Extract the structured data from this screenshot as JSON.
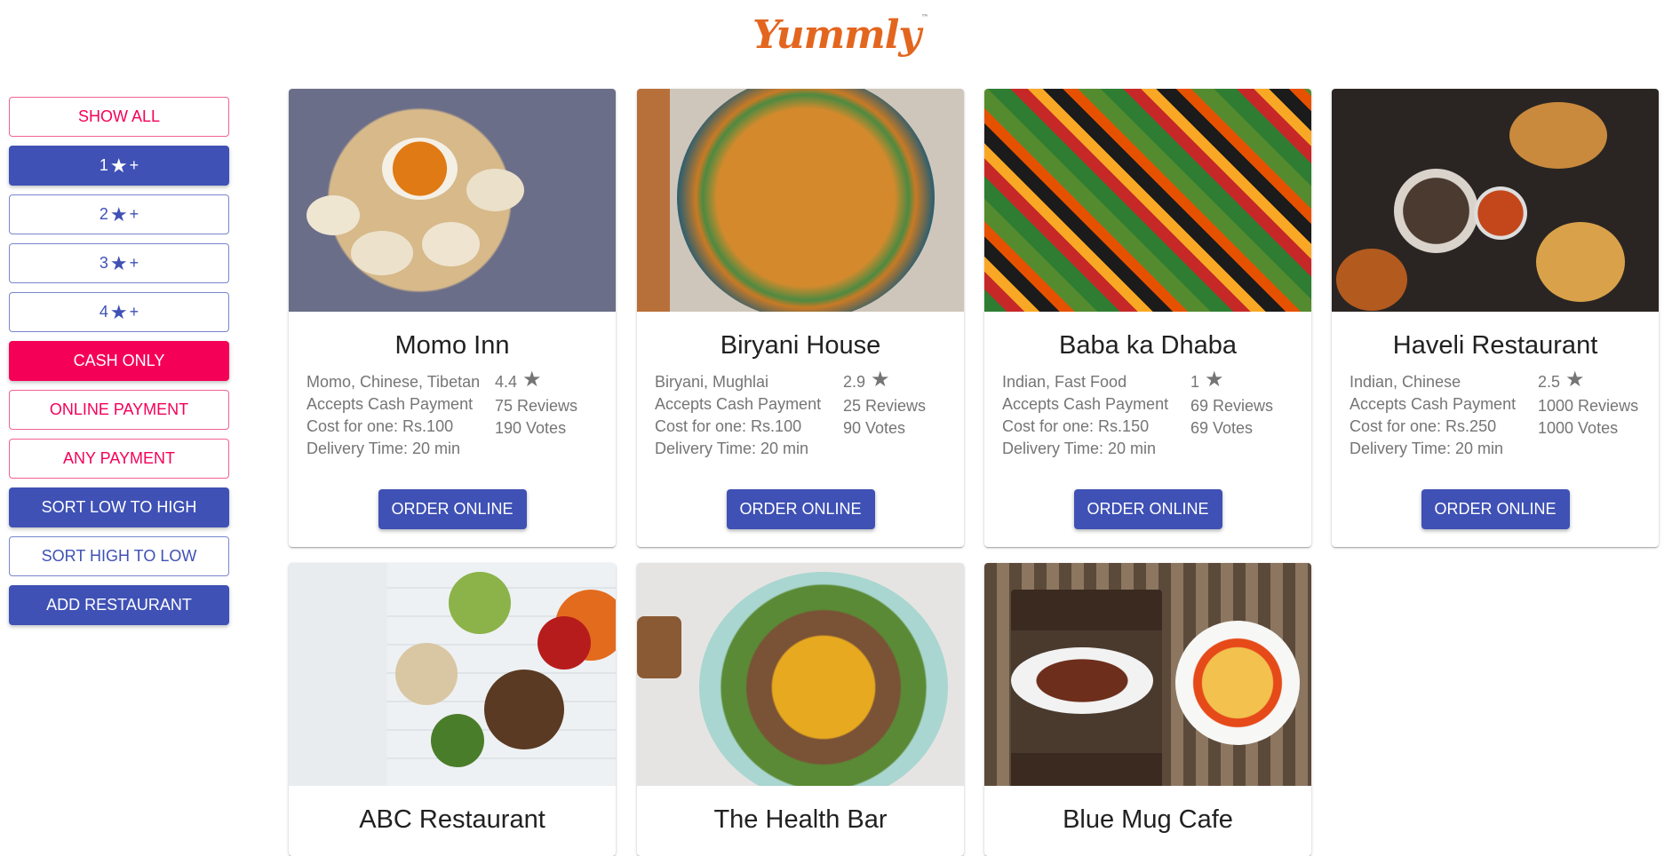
{
  "header": {
    "logo_text": "Yummly",
    "logo_mark": "™"
  },
  "filters": [
    {
      "label_pre": "SHOW ALL",
      "star": "",
      "label_post": "",
      "style": "o-pink"
    },
    {
      "label_pre": "1",
      "star": "★",
      "label_post": "+",
      "style": "c-indigo"
    },
    {
      "label_pre": "2",
      "star": "★",
      "label_post": "+",
      "style": "o-indigo"
    },
    {
      "label_pre": "3",
      "star": "★",
      "label_post": "+",
      "style": "o-indigo"
    },
    {
      "label_pre": "4",
      "star": "★",
      "label_post": "+",
      "style": "o-indigo"
    },
    {
      "label_pre": "CASH ONLY",
      "star": "",
      "label_post": "",
      "style": "c-pink"
    },
    {
      "label_pre": "ONLINE PAYMENT",
      "star": "",
      "label_post": "",
      "style": "o-pink"
    },
    {
      "label_pre": "ANY PAYMENT",
      "star": "",
      "label_post": "",
      "style": "o-pink"
    },
    {
      "label_pre": "SORT LOW TO HIGH",
      "star": "",
      "label_post": "",
      "style": "c-indigo"
    },
    {
      "label_pre": "SORT HIGH TO LOW",
      "star": "",
      "label_post": "",
      "style": "o-indigo"
    },
    {
      "label_pre": "ADD RESTAURANT",
      "star": "",
      "label_post": "",
      "style": "c-indigo"
    }
  ],
  "restaurants": [
    {
      "name": "Momo Inn",
      "cuisine": "Momo, Chinese, Tibetan",
      "payment": "Accepts Cash Payment",
      "cost": "Cost for one: Rs.100",
      "delivery": "Delivery Time: 20 min",
      "rating": "4.4",
      "reviews": "75 Reviews",
      "votes": "190 Votes",
      "order_label": "ORDER ONLINE"
    },
    {
      "name": "Biryani House",
      "cuisine": "Biryani, Mughlai",
      "payment": "Accepts Cash Payment",
      "cost": "Cost for one: Rs.100",
      "delivery": "Delivery Time: 20 min",
      "rating": "2.9",
      "reviews": "25 Reviews",
      "votes": "90 Votes",
      "order_label": "ORDER ONLINE"
    },
    {
      "name": "Baba ka Dhaba",
      "cuisine": "Indian, Fast Food",
      "payment": "Accepts Cash Payment",
      "cost": "Cost for one: Rs.150",
      "delivery": "Delivery Time: 20 min",
      "rating": "1",
      "reviews": "69 Reviews",
      "votes": "69 Votes",
      "order_label": "ORDER ONLINE"
    },
    {
      "name": "Haveli Restaurant",
      "cuisine": "Indian, Chinese",
      "payment": "Accepts Cash Payment",
      "cost": "Cost for one: Rs.250",
      "delivery": "Delivery Time: 20 min",
      "rating": "2.5",
      "reviews": "1000 Reviews",
      "votes": "1000 Votes",
      "order_label": "ORDER ONLINE"
    },
    {
      "name": "ABC Restaurant"
    },
    {
      "name": "The Health Bar"
    },
    {
      "name": "Blue Mug Cafe"
    }
  ],
  "rating_star": "★",
  "colors": {
    "primary": "#3f51b5",
    "secondary": "#f50057",
    "logo": "#e3661f"
  }
}
